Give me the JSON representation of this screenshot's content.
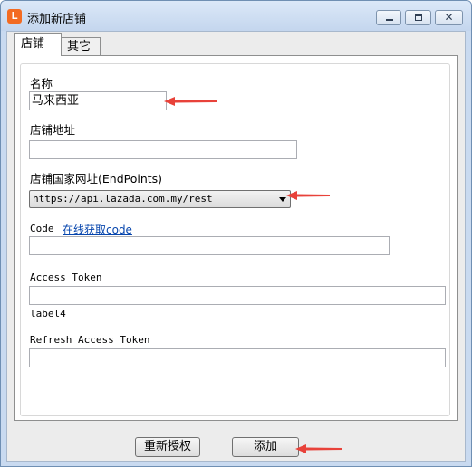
{
  "window": {
    "title": "添加新店铺",
    "app_icon_glyph": "L"
  },
  "tabs": [
    {
      "label": "店铺",
      "active": true
    },
    {
      "label": "其它",
      "active": false
    }
  ],
  "form": {
    "name_label": "名称",
    "name_value": "马来西亚",
    "address_label": "店铺地址",
    "address_value": "",
    "endpoint_label": "店铺国家网址(EndPoints)",
    "endpoint_value": "https://api.lazada.com.my/rest",
    "code_label": "Code",
    "code_link": "在线获取code",
    "code_value": "",
    "access_token_label": "Access Token",
    "access_token_value": "",
    "label4": "label4",
    "refresh_token_label": "Refresh Access Token",
    "refresh_token_value": ""
  },
  "buttons": {
    "reauthorize": "重新授权",
    "add": "添加"
  },
  "colors": {
    "annotation_arrow": "#e8423a",
    "link": "#0645ad"
  }
}
